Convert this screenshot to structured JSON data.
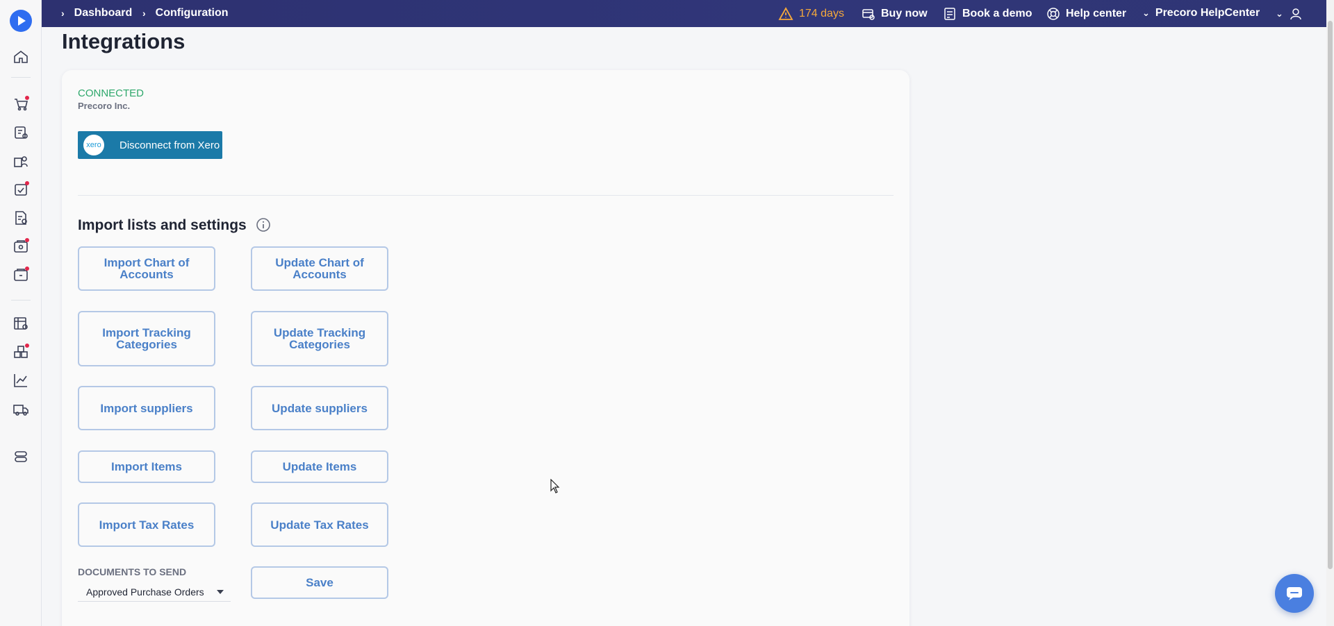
{
  "topbar": {
    "breadcrumbs": [
      "Dashboard",
      "Configuration"
    ],
    "trial_warning": "174 days",
    "buy_now": "Buy now",
    "book_demo": "Book a demo",
    "help_center": "Help center",
    "company_selector": "Precoro HelpCenter"
  },
  "page": {
    "title": "Integrations"
  },
  "integration": {
    "status": "CONNECTED",
    "company": "Precoro Inc.",
    "logo_text": "xero",
    "disconnect_label": "Disconnect from Xero"
  },
  "import_section": {
    "title": "Import lists and settings",
    "buttons": [
      "Import Chart of Accounts",
      "Update Chart of Accounts",
      "Import Tracking Categories",
      "Update Tracking Categories",
      "Import suppliers",
      "Update suppliers",
      "Import Items",
      "Update Items",
      "Import Tax Rates",
      "Update Tax Rates"
    ]
  },
  "documents": {
    "label": "DOCUMENTS TO SEND",
    "selected": "Approved Purchase Orders",
    "save_label": "Save"
  },
  "colors": {
    "topbar": "#2d3170",
    "accent": "#4a80c8",
    "connected": "#2fa86c",
    "xero_button": "#1b7aa8",
    "warning": "#f6a93b"
  },
  "icons": {
    "sidebar": [
      "home-icon",
      "cart-icon",
      "requisition-icon",
      "suppliers-icon",
      "approval-icon",
      "invoice-icon",
      "receipt-icon",
      "payment-icon",
      "budget-icon",
      "inventory-icon",
      "analytics-icon",
      "delivery-icon",
      "settings-icon"
    ],
    "topbar": [
      "warning-icon",
      "buy-icon",
      "calendar-icon",
      "help-icon",
      "user-icon"
    ]
  }
}
